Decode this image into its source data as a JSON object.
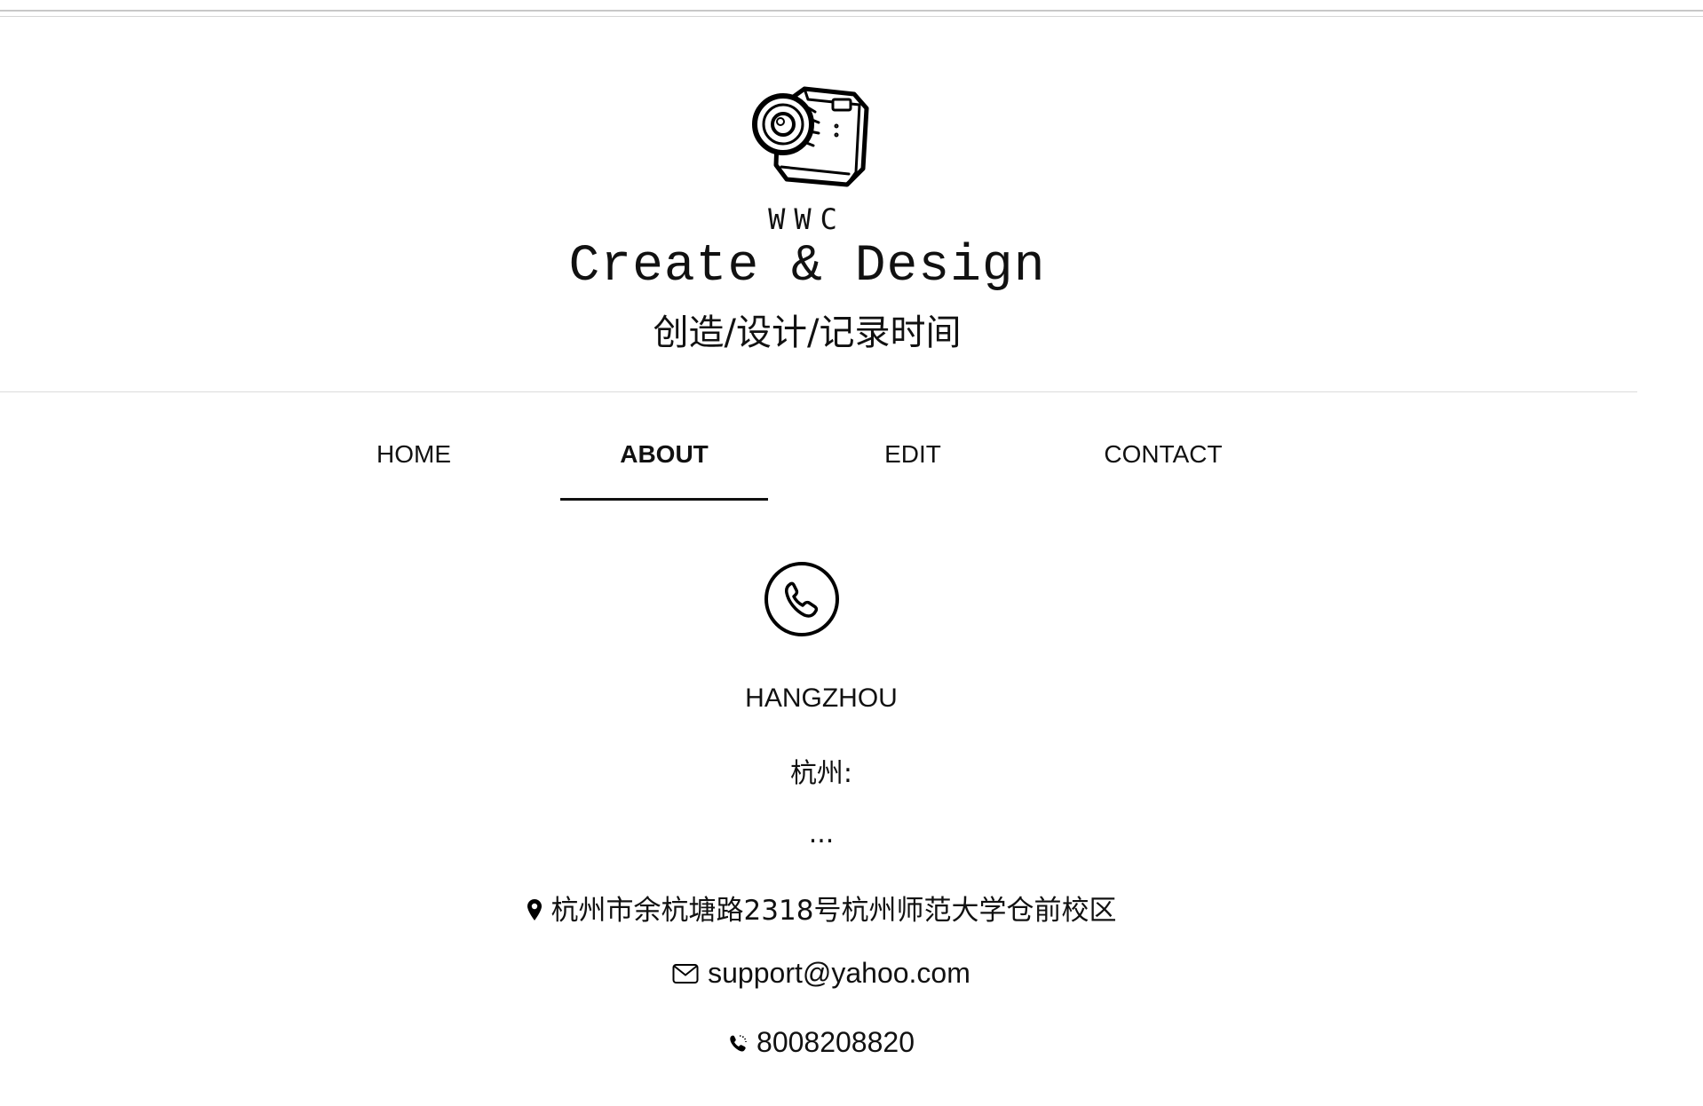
{
  "header": {
    "logo_icon": "camera-sketch-icon",
    "brand": "WWC",
    "tagline": "Create & Design",
    "subtagline": "创造/设计/记录时间"
  },
  "nav": {
    "items": [
      {
        "label": "HOME",
        "active": false
      },
      {
        "label": "ABOUT",
        "active": true
      },
      {
        "label": "EDIT",
        "active": false
      },
      {
        "label": "CONTACT",
        "active": false
      }
    ]
  },
  "contact": {
    "icon": "phone-circle-icon",
    "city": "HANGZHOU",
    "city_cn": "杭州:",
    "ellipsis": "...",
    "address": "杭州市余杭塘路2318号杭州师范大学仓前校区",
    "email": "support@yahoo.com",
    "phone": "8008208820"
  }
}
